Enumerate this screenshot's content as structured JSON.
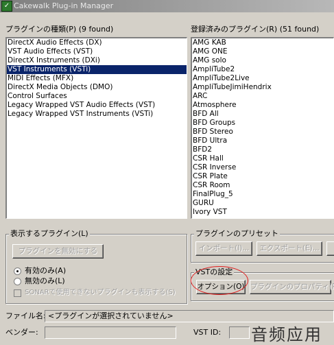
{
  "window": {
    "title": "Cakewalk Plug-in Manager"
  },
  "plugin_types": {
    "label": "プラグインの種類(P) (9 found)",
    "items": [
      {
        "label": "DirectX Audio Effects (DX)",
        "selected": false
      },
      {
        "label": "VST Audio Effects (VST)",
        "selected": false
      },
      {
        "label": "DirectX Instruments (DXi)",
        "selected": false
      },
      {
        "label": "VST Instruments (VSTi)",
        "selected": true
      },
      {
        "label": "MIDI Effects (MFX)",
        "selected": false
      },
      {
        "label": "DirectX Media Objects (DMO)",
        "selected": false
      },
      {
        "label": "Control Surfaces",
        "selected": false
      },
      {
        "label": "Legacy Wrapped VST Audio Effects (VST)",
        "selected": false
      },
      {
        "label": "Legacy Wrapped VST Instruments (VSTi)",
        "selected": false
      }
    ]
  },
  "registered_plugins": {
    "label": "登録済みのプラグイン(R) (51 found)",
    "items": [
      "AMG KAB",
      "AMG ONE",
      "AMG solo",
      "AmpliTube2",
      "AmpliTube2Live",
      "AmpliTubeJimiHendrix",
      "ARC",
      "Atmosphere",
      "BFD All",
      "BFD Groups",
      "BFD Stereo",
      "BFD Ultra",
      "BFD2",
      "CSR Hall",
      "CSR Inverse",
      "CSR Plate",
      "CSR Room",
      "FinalPlug_5",
      "GURU",
      "Ivory VST"
    ]
  },
  "display_group": {
    "title": "表示するプラグイン(L)",
    "disable_button": "プラグインを無効にする",
    "radio_enabled": "有効のみ(A)",
    "radio_disabled": "無効のみ(L)",
    "checkbox_label": "SONARで使用できないプラグインも表示する(S)"
  },
  "preset_group": {
    "title": "プラグインのプリセット",
    "import_button": "インポート(I)...",
    "export_button": "エクスポート(E)..."
  },
  "vst_group": {
    "title": "VSTの設定",
    "options_button": "オプション(O)",
    "properties_button": "プラグインのプロパティ(P)"
  },
  "footer": {
    "filename_label": "ファイル名:",
    "filename_value": "<プラグインが選択されていません>",
    "vendor_label": "ベンダー:",
    "vendor_value": "",
    "vstid_label": "VST ID:",
    "vstid_value": ""
  },
  "watermark": "音频应用"
}
